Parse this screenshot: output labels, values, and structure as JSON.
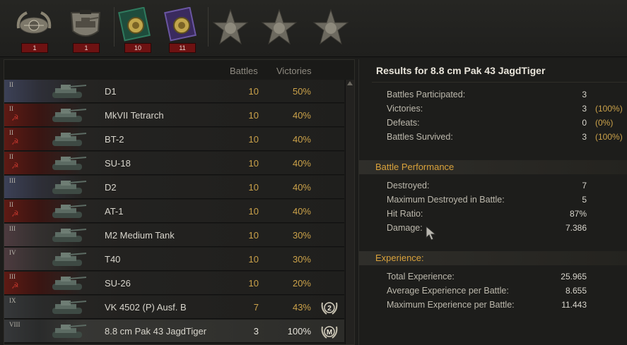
{
  "achievements": [
    {
      "icon": "sniper-badge-icon",
      "count": "1"
    },
    {
      "icon": "tank-shield-badge-icon",
      "count": "1"
    },
    {
      "icon": "green-medal-icon",
      "count": "10"
    },
    {
      "icon": "purple-medal-icon",
      "count": "11"
    },
    {
      "icon": "star-medal-1-icon"
    },
    {
      "icon": "star-medal-2-icon"
    },
    {
      "icon": "star-medal-3-icon"
    }
  ],
  "list": {
    "col_battles": "Battles",
    "col_victories": "Victories",
    "rows": [
      {
        "tier": "II",
        "nation": "czech",
        "name": "D1",
        "battles": "10",
        "victories": "50%"
      },
      {
        "tier": "II",
        "nation": "ussr",
        "name": "MkVII Tetrarch",
        "battles": "10",
        "victories": "40%"
      },
      {
        "tier": "II",
        "nation": "ussr",
        "name": "BT-2",
        "battles": "10",
        "victories": "40%"
      },
      {
        "tier": "II",
        "nation": "ussr",
        "name": "SU-18",
        "battles": "10",
        "victories": "40%"
      },
      {
        "tier": "III",
        "nation": "czech",
        "name": "D2",
        "battles": "10",
        "victories": "40%"
      },
      {
        "tier": "II",
        "nation": "ussr",
        "name": "AT-1",
        "battles": "10",
        "victories": "40%"
      },
      {
        "tier": "III",
        "nation": "usa",
        "name": "M2 Medium Tank",
        "battles": "10",
        "victories": "30%"
      },
      {
        "tier": "IV",
        "nation": "usa",
        "name": "T40",
        "battles": "10",
        "victories": "30%"
      },
      {
        "tier": "III",
        "nation": "ussr",
        "name": "SU-26",
        "battles": "10",
        "victories": "20%"
      },
      {
        "tier": "IX",
        "nation": "germany",
        "name": "VK 4502 (P) Ausf. B",
        "battles": "7",
        "victories": "43%",
        "mastery": "2"
      },
      {
        "tier": "VIII",
        "nation": "germany",
        "name": "8.8 cm Pak 43 JagdTiger",
        "battles": "3",
        "victories": "100%",
        "mastery": "M"
      }
    ]
  },
  "details": {
    "title": "Results for 8.8 cm Pak 43 JagdTiger",
    "summary": [
      {
        "label": "Battles Participated:",
        "value": "3",
        "pct": ""
      },
      {
        "label": "Victories:",
        "value": "3",
        "pct": "(100%)"
      },
      {
        "label": "Defeats:",
        "value": "0",
        "pct": "(0%)"
      },
      {
        "label": "Battles Survived:",
        "value": "3",
        "pct": "(100%)"
      }
    ],
    "performance_title": "Battle Performance",
    "performance": [
      {
        "label": "Destroyed:",
        "value": "7"
      },
      {
        "label": "Maximum Destroyed in Battle:",
        "value": "5"
      },
      {
        "label": "Hit Ratio:",
        "value": "87%"
      },
      {
        "label": "Damage:",
        "value": "7.386"
      }
    ],
    "experience_title": "Experience:",
    "experience": [
      {
        "label": "Total Experience:",
        "value": "25.965"
      },
      {
        "label": "Average Experience per Battle:",
        "value": "8.655"
      },
      {
        "label": "Maximum Experience per Battle:",
        "value": "11.443"
      }
    ]
  }
}
